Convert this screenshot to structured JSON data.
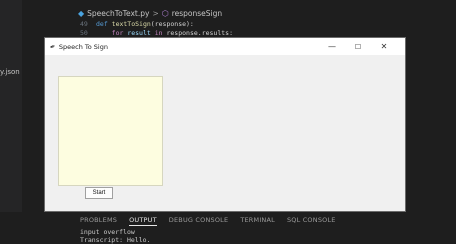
{
  "editor": {
    "breadcrumb": {
      "file": "SpeechToText.py",
      "separator": ">",
      "symbol": "responseSign"
    },
    "code_lines": [
      {
        "line_no": "49",
        "parts": [
          {
            "t": "def ",
            "c": "kw2"
          },
          {
            "t": "textToSign",
            "c": "fn"
          },
          {
            "t": "(response):",
            "c": "plain"
          }
        ]
      },
      {
        "line_no": "50",
        "parts": [
          {
            "t": "    for ",
            "c": "kw"
          },
          {
            "t": "result ",
            "c": "var"
          },
          {
            "t": "in ",
            "c": "kw"
          },
          {
            "t": "response.results:",
            "c": "plain"
          }
        ]
      }
    ],
    "explorer_file": "y.json"
  },
  "panel": {
    "tabs": [
      {
        "label": "PROBLEMS",
        "active": false
      },
      {
        "label": "OUTPUT",
        "active": true
      },
      {
        "label": "DEBUG CONSOLE",
        "active": false
      },
      {
        "label": "TERMINAL",
        "active": false
      },
      {
        "label": "SQL CONSOLE",
        "active": false
      }
    ],
    "output_lines": [
      "input overflow",
      "Transcript: Hello."
    ]
  },
  "window": {
    "title": "Speech To Sign",
    "controls": {
      "minimize": "—",
      "maximize": "☐",
      "close": "✕"
    },
    "start_button_label": "Start"
  },
  "colors": {
    "canvas_bg": "#fdfde0",
    "window_bg": "#f0f0f0",
    "editor_bg": "#1e1e1e"
  }
}
